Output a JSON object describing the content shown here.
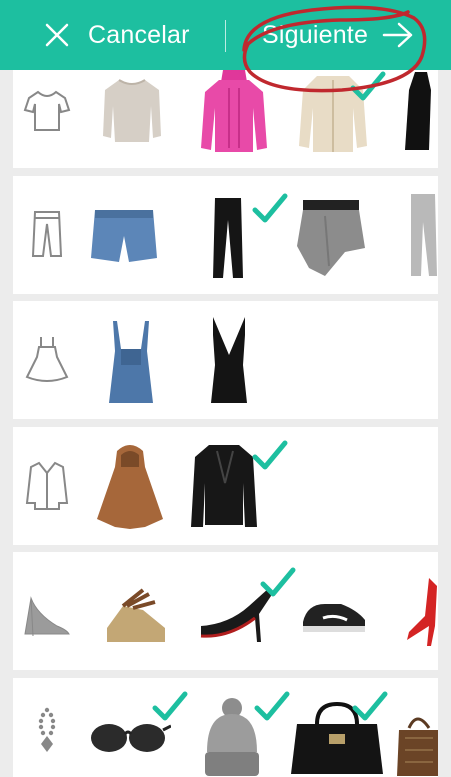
{
  "header": {
    "cancel_label": "Cancelar",
    "next_label": "Siguiente"
  },
  "colors": {
    "accent": "#1dbfa0",
    "check": "#1dbfa0",
    "annotation": "#c0282e",
    "category_icon": "#888888"
  },
  "categories": [
    {
      "icon": "tshirt-icon",
      "items": [
        "beige-sweater",
        "pink-sweater",
        "cream-cardigan",
        "black-top"
      ],
      "checked": [
        false,
        false,
        true,
        false
      ]
    },
    {
      "icon": "pants-icon",
      "items": [
        "denim-shorts",
        "black-trousers",
        "grey-skirt",
        "grey-sweatpants"
      ],
      "checked": [
        false,
        true,
        false,
        false
      ]
    },
    {
      "icon": "dress-icon",
      "items": [
        "denim-overalls",
        "black-dress"
      ],
      "checked": [
        false,
        false
      ]
    },
    {
      "icon": "coat-icon",
      "items": [
        "brown-cape",
        "black-leather-jacket"
      ],
      "checked": [
        false,
        true
      ]
    },
    {
      "icon": "high-heel-icon",
      "items": [
        "wedge-sandal",
        "black-stiletto",
        "sneaker",
        "red-heels"
      ],
      "checked": [
        false,
        true,
        false,
        false
      ]
    },
    {
      "icon": "necklace-icon",
      "items": [
        "sunglasses",
        "grey-beanie",
        "black-handbag",
        "brown-handbag"
      ],
      "checked": [
        true,
        true,
        true,
        false
      ]
    }
  ]
}
